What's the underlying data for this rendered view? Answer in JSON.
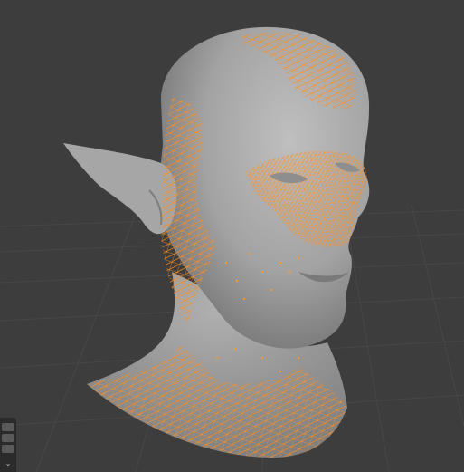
{
  "app": {
    "type": "3d-viewport",
    "mode_label": ""
  },
  "viewport": {
    "background_color": "#3d3d3d",
    "grid_color": "#4a4a4a",
    "mesh_color": "#9a9a9a",
    "selection_color": "#ff8c1a",
    "object": "head-sculpt-with-pointed-ear",
    "selected_regions": [
      "crown-patch",
      "temple-and-cheek-band",
      "eye-and-nose-area",
      "neck-base"
    ]
  },
  "side_panel": {
    "collapse_icon": "chevron-down-icon",
    "title": ""
  }
}
